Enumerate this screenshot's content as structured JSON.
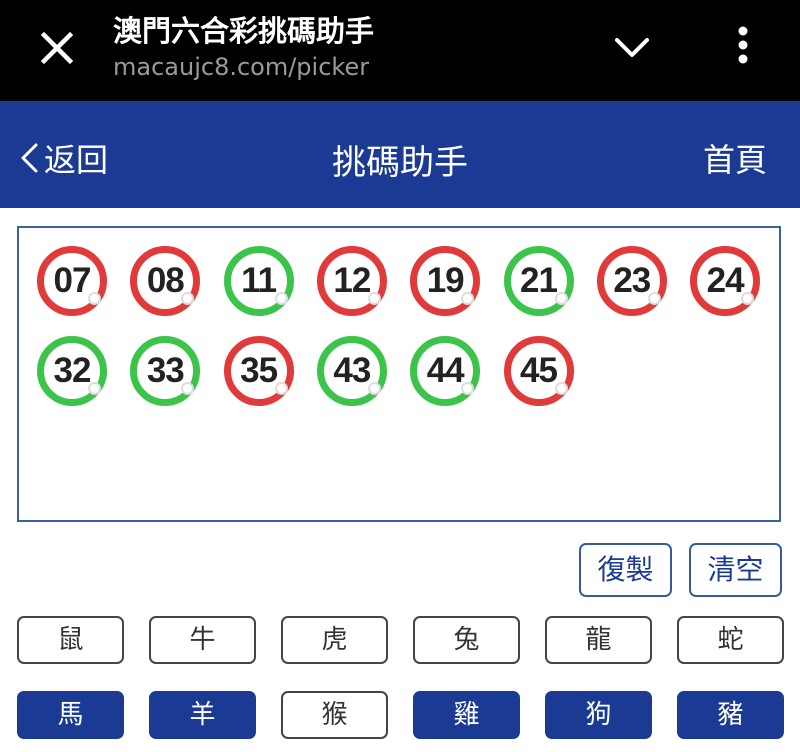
{
  "browser": {
    "title": "澳門六合彩挑碼助手",
    "url": "macaujc8.com/picker"
  },
  "nav": {
    "back_label": "返回",
    "title": "挑碼助手",
    "home_label": "首頁"
  },
  "balls": [
    {
      "number": "07",
      "color": "red"
    },
    {
      "number": "08",
      "color": "red"
    },
    {
      "number": "11",
      "color": "green"
    },
    {
      "number": "12",
      "color": "red"
    },
    {
      "number": "19",
      "color": "red"
    },
    {
      "number": "21",
      "color": "green"
    },
    {
      "number": "23",
      "color": "red"
    },
    {
      "number": "24",
      "color": "red"
    },
    {
      "number": "32",
      "color": "green"
    },
    {
      "number": "33",
      "color": "green"
    },
    {
      "number": "35",
      "color": "red"
    },
    {
      "number": "43",
      "color": "green"
    },
    {
      "number": "44",
      "color": "green"
    },
    {
      "number": "45",
      "color": "red"
    }
  ],
  "actions": {
    "copy_label": "復製",
    "clear_label": "清空"
  },
  "zodiacs": [
    {
      "label": "鼠",
      "selected": false
    },
    {
      "label": "牛",
      "selected": false
    },
    {
      "label": "虎",
      "selected": false
    },
    {
      "label": "兔",
      "selected": false
    },
    {
      "label": "龍",
      "selected": false
    },
    {
      "label": "蛇",
      "selected": false
    },
    {
      "label": "馬",
      "selected": true
    },
    {
      "label": "羊",
      "selected": true
    },
    {
      "label": "猴",
      "selected": false
    },
    {
      "label": "雞",
      "selected": true
    },
    {
      "label": "狗",
      "selected": true
    },
    {
      "label": "豬",
      "selected": true
    }
  ],
  "colors": {
    "primary": "#1b3a94",
    "ball_red": "#e13a3a",
    "ball_green": "#3cc44a"
  }
}
